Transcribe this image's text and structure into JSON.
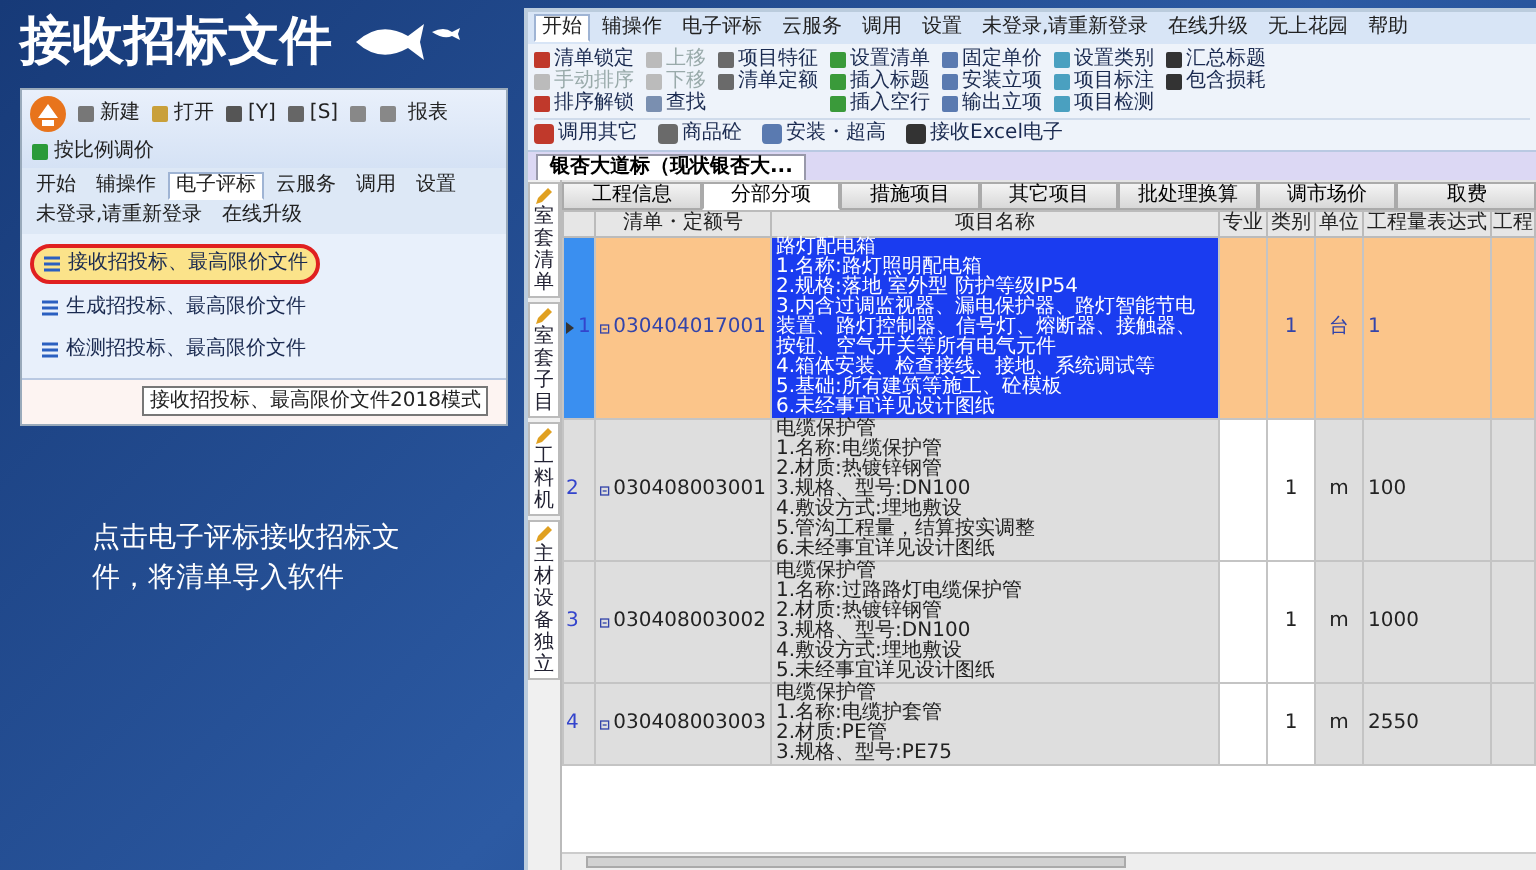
{
  "slide_title": "接收招标文件",
  "caption": "点击电子评标接收招标文件，将清单导入软件",
  "screenshot_1": {
    "quick_access": [
      {
        "kind": "new",
        "label": "新建"
      },
      {
        "kind": "open",
        "label": "打开"
      },
      {
        "kind": "save",
        "label": "[Y]"
      },
      {
        "kind": "copy",
        "label": "[S]"
      },
      {
        "kind": "undo"
      },
      {
        "kind": "redo"
      },
      {
        "kind": "text",
        "label": "报表"
      },
      {
        "kind": "scale",
        "label": "按比例调价"
      }
    ],
    "tabs": [
      {
        "label": "开始",
        "selected": false
      },
      {
        "label": "辅操作",
        "selected": false
      },
      {
        "label": "电子评标",
        "selected": true
      },
      {
        "label": "云服务",
        "selected": false
      },
      {
        "label": "调用",
        "selected": false
      },
      {
        "label": "设置",
        "selected": false
      },
      {
        "label": "未登录,请重新登录",
        "selected": false
      },
      {
        "label": "在线升级",
        "selected": false
      }
    ],
    "ribbon_buttons": [
      {
        "label": "接收招投标、最高限价文件",
        "highlighted": true,
        "circled": true
      },
      {
        "label": "生成招投标、最高限价文件",
        "highlighted": false,
        "circled": false
      },
      {
        "label": "检测招投标、最高限价文件",
        "highlighted": false,
        "circled": false
      }
    ],
    "tooltip": "接收招投标、最高限价文件2018模式"
  },
  "screenshot_2": {
    "tabs": [
      {
        "label": "开始",
        "selected": true
      },
      {
        "label": "辅操作",
        "selected": false
      },
      {
        "label": "电子评标",
        "selected": false
      },
      {
        "label": "云服务",
        "selected": false
      },
      {
        "label": "调用",
        "selected": false
      },
      {
        "label": "设置",
        "selected": false
      },
      {
        "label": "未登录,请重新登录",
        "selected": false
      },
      {
        "label": "在线升级",
        "selected": false
      },
      {
        "label": "无上花园",
        "selected": false
      },
      {
        "label": "帮助",
        "selected": false
      }
    ],
    "toolbar_groups": [
      [
        {
          "label": "清单锁定",
          "disabled": false
        },
        {
          "label": "手动排序",
          "disabled": true
        },
        {
          "label": "排序解锁",
          "disabled": false
        }
      ],
      [
        {
          "label": "上移",
          "disabled": true
        },
        {
          "label": "下移",
          "disabled": true
        },
        {
          "label": "查找",
          "disabled": false
        }
      ],
      [
        {
          "label": "项目特征",
          "disabled": false
        },
        {
          "label": "清单定额",
          "disabled": false
        }
      ],
      [
        {
          "label": "设置清单",
          "disabled": false
        },
        {
          "label": "插入标题",
          "disabled": false
        },
        {
          "label": "插入空行",
          "disabled": false
        }
      ],
      [
        {
          "label": "固定单价",
          "disabled": false
        },
        {
          "label": "安装立项",
          "disabled": false
        },
        {
          "label": "输出立项",
          "disabled": false
        }
      ],
      [
        {
          "label": "设置类别",
          "disabled": false
        },
        {
          "label": "项目标注",
          "disabled": false
        },
        {
          "label": "项目检测",
          "disabled": false
        }
      ],
      [
        {
          "label": "汇总标题",
          "disabled": false
        },
        {
          "label": "包含损耗",
          "disabled": false
        }
      ]
    ],
    "big_buttons": [
      "调用其它",
      "商品砼",
      "安装・超高",
      "接收Excel电子"
    ],
    "document_tab": "银杏大道标（现状银杏大...",
    "side_tabs": [
      {
        "label": "室套清单",
        "selected": false
      },
      {
        "label": "室套子目",
        "selected": false
      },
      {
        "label": "工料机",
        "selected": false
      },
      {
        "label": "主材设备独立",
        "selected": false
      }
    ],
    "sheet_tabs": [
      {
        "label": "工程信息",
        "selected": false
      },
      {
        "label": "分部分项",
        "selected": true
      },
      {
        "label": "措施项目",
        "selected": false
      },
      {
        "label": "其它项目",
        "selected": false
      },
      {
        "label": "批处理换算",
        "selected": false
      },
      {
        "label": "调市场价",
        "selected": false
      },
      {
        "label": "取费",
        "selected": false
      }
    ],
    "table": {
      "columns": [
        "清单・定额号",
        "项目名称",
        "专业",
        "类别",
        "单位",
        "工程量表达式",
        "工程"
      ],
      "rows": [
        {
          "selected": true,
          "number": "1",
          "code": "030404017001",
          "description": [
            "路灯配电箱",
            "1.名称:路灯照明配电箱",
            "2.规格:落地 室外型 防护等级IP54",
            "3.内含过调监视器、漏电保护器、路灯智能节电装置、路灯控制器、信号灯、熔断器、接触器、按钮、空气开关等所有电气元件",
            "4.箱体安装、检查接线、接地、系统调试等",
            "5.基础:所有建筑等施工、砼模板",
            "6.未经事宜详见设计图纸"
          ],
          "category": "1",
          "unit": "台",
          "expression": "1"
        },
        {
          "selected": false,
          "number": "2",
          "code": "030408003001",
          "description": [
            "电缆保护管",
            "1.名称:电缆保护管",
            "2.材质:热镀锌钢管",
            "3.规格、型号:DN100",
            "4.敷设方式:埋地敷设",
            "5.管沟工程量，结算按实调整",
            "6.未经事宜详见设计图纸"
          ],
          "category": "1",
          "unit": "m",
          "expression": "100"
        },
        {
          "selected": false,
          "number": "3",
          "code": "030408003002",
          "description": [
            "电缆保护管",
            "1.名称:过路路灯电缆保护管",
            "2.材质:热镀锌钢管",
            "3.规格、型号:DN100",
            "4.敷设方式:埋地敷设",
            "5.未经事宜详见设计图纸"
          ],
          "category": "1",
          "unit": "m",
          "expression": "1000"
        },
        {
          "selected": false,
          "number": "4",
          "code": "030408003003",
          "description": [
            "电缆保护管",
            "1.名称:电缆护套管",
            "2.材质:PE管",
            "3.规格、型号:PE75"
          ],
          "category": "1",
          "unit": "m",
          "expression": "2550"
        }
      ]
    }
  }
}
